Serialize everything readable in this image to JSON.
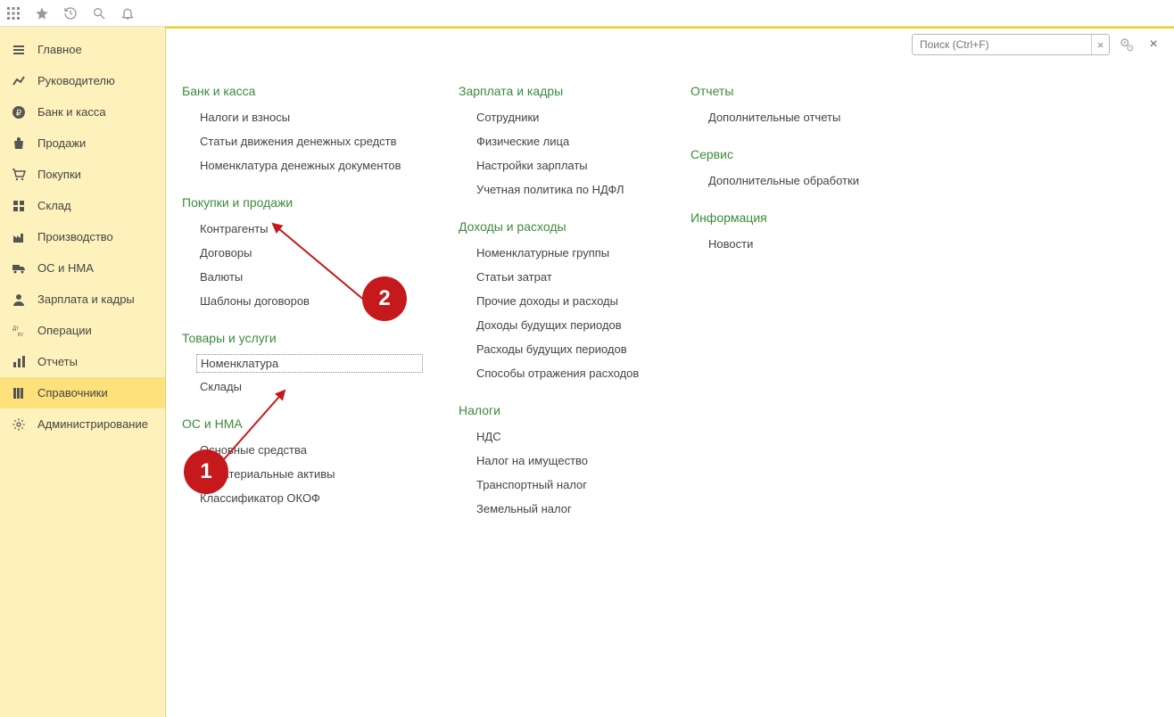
{
  "topbar": {
    "apps_icon": "apps",
    "star_icon": "star",
    "history_icon": "history",
    "search_icon": "search",
    "bell_icon": "bell"
  },
  "sidebar": {
    "items": [
      {
        "label": "Главное",
        "icon": "menu"
      },
      {
        "label": "Руководителю",
        "icon": "chart"
      },
      {
        "label": "Банк и касса",
        "icon": "ruble"
      },
      {
        "label": "Продажи",
        "icon": "bag"
      },
      {
        "label": "Покупки",
        "icon": "cart"
      },
      {
        "label": "Склад",
        "icon": "boxes"
      },
      {
        "label": "Производство",
        "icon": "factory"
      },
      {
        "label": "ОС и НМА",
        "icon": "truck"
      },
      {
        "label": "Зарплата и кадры",
        "icon": "person"
      },
      {
        "label": "Операции",
        "icon": "dtcr"
      },
      {
        "label": "Отчеты",
        "icon": "bars"
      },
      {
        "label": "Справочники",
        "icon": "books",
        "active": true
      },
      {
        "label": "Администрирование",
        "icon": "gear"
      }
    ]
  },
  "header": {
    "search_placeholder": "Поиск (Ctrl+F)",
    "clear": "×",
    "close": "×"
  },
  "columns": [
    {
      "sections": [
        {
          "title": "Банк и касса",
          "links": [
            "Налоги и взносы",
            "Статьи движения денежных средств",
            "Номенклатура денежных документов"
          ]
        },
        {
          "title": "Покупки и продажи",
          "links": [
            "Контрагенты",
            "Договоры",
            "Валюты",
            "Шаблоны договоров"
          ]
        },
        {
          "title": "Товары и услуги",
          "links": [
            "Номенклатура",
            "Склады"
          ],
          "selected_index": 0
        },
        {
          "title": "ОС и НМА",
          "links": [
            "Основные средства",
            "Нематериальные активы",
            "Классификатор ОКОФ"
          ]
        }
      ]
    },
    {
      "sections": [
        {
          "title": "Зарплата и кадры",
          "links": [
            "Сотрудники",
            "Физические лица",
            "Настройки зарплаты",
            "Учетная политика по НДФЛ"
          ]
        },
        {
          "title": "Доходы и расходы",
          "links": [
            "Номенклатурные группы",
            "Статьи затрат",
            "Прочие доходы и расходы",
            "Доходы будущих периодов",
            "Расходы будущих периодов",
            "Способы отражения расходов"
          ]
        },
        {
          "title": "Налоги",
          "links": [
            "НДС",
            "Налог на имущество",
            "Транспортный налог",
            "Земельный налог"
          ]
        }
      ]
    },
    {
      "sections": [
        {
          "title": "Отчеты",
          "links": [
            "Дополнительные отчеты"
          ]
        },
        {
          "title": "Сервис",
          "links": [
            "Дополнительные обработки"
          ]
        },
        {
          "title": "Информация",
          "links": [
            "Новости"
          ]
        }
      ]
    }
  ],
  "markers": {
    "m1": "1",
    "m2": "2"
  }
}
